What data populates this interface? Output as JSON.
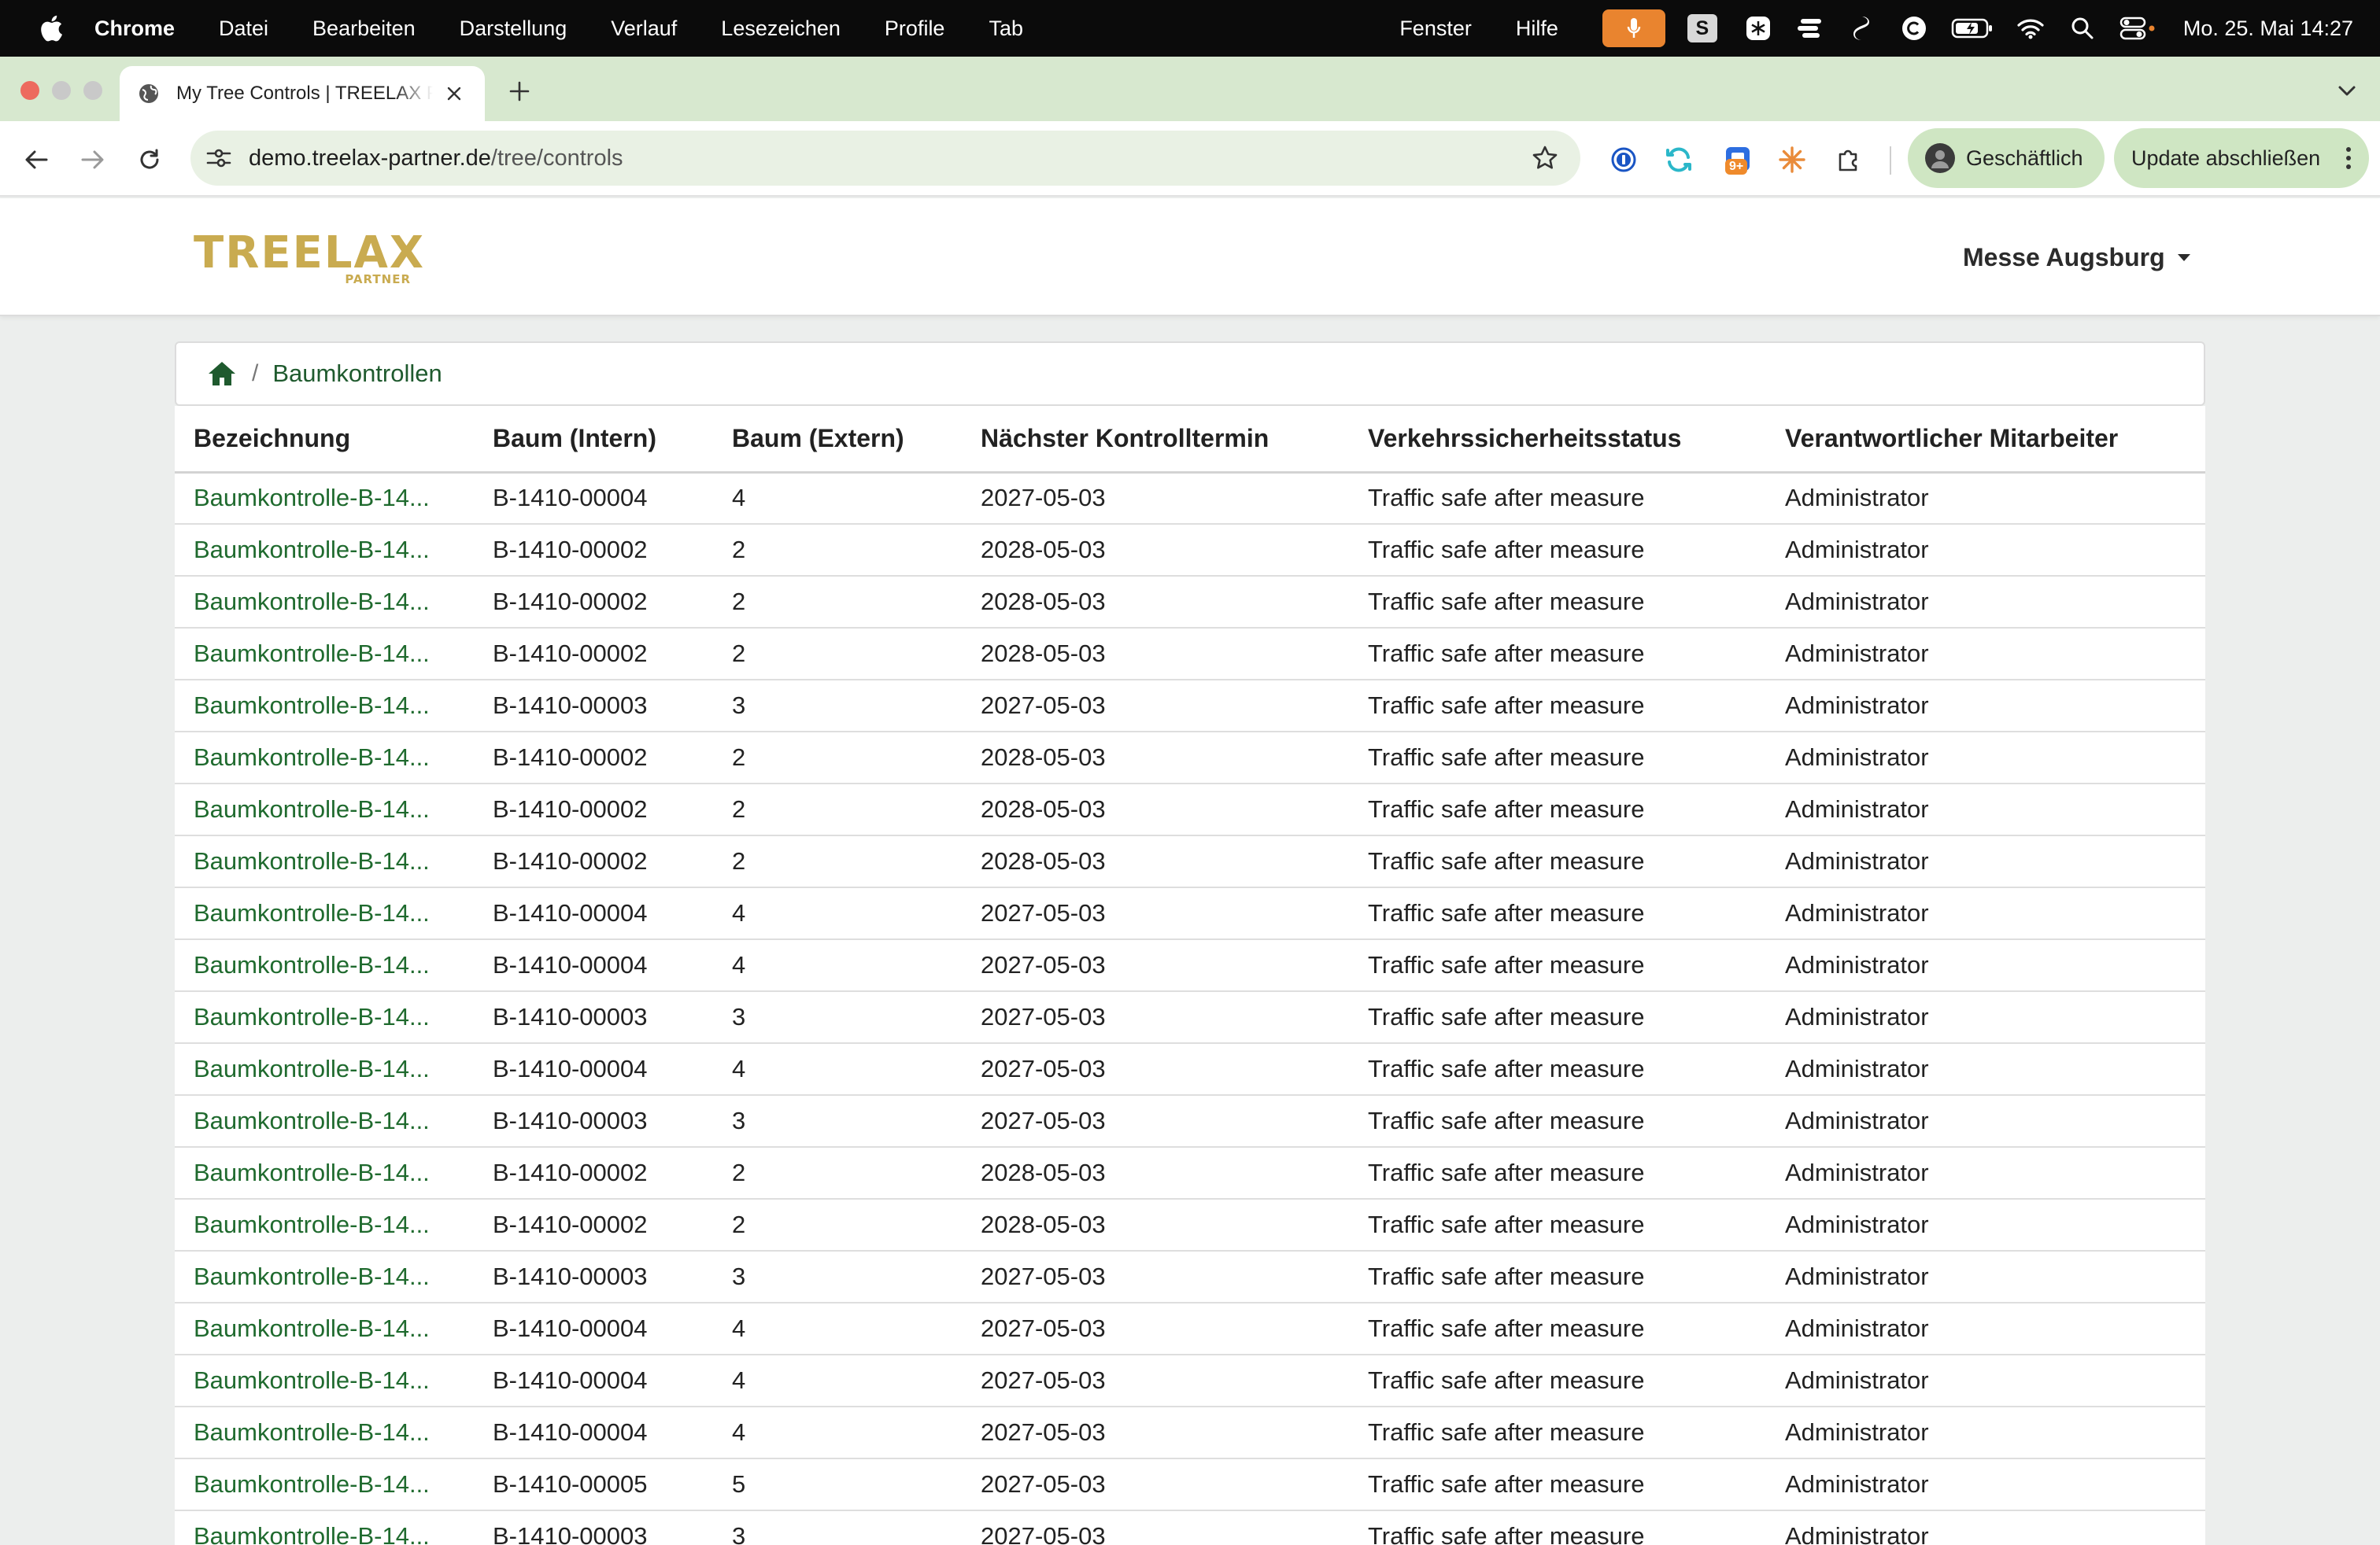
{
  "menubar": {
    "app_name": "Chrome",
    "menus": [
      "Datei",
      "Bearbeiten",
      "Darstellung",
      "Verlauf",
      "Lesezeichen",
      "Profile",
      "Tab"
    ],
    "right_menus": [
      "Fenster",
      "Hilfe"
    ],
    "s_icon_label": "S",
    "clock": "Mo. 25. Mai  14:27",
    "accent_color": "#e9842f"
  },
  "browser": {
    "tab_title": "My Tree Controls | TREELAX Partner",
    "url_host": "demo.treelax-partner.de",
    "url_path": "/tree/controls",
    "extension_badge": "9+",
    "profile_label": "Geschäftlich",
    "update_label": "Update abschließen",
    "chrome_color": "#d7e8cf"
  },
  "header": {
    "logo_text": "TREELAX",
    "logo_subtext": "PARTNER",
    "org_selector": "Messe Augsburg",
    "brand_color": "#c9ab50"
  },
  "breadcrumb": {
    "current": "Baumkontrollen"
  },
  "table": {
    "columns": [
      "Bezeichnung",
      "Baum (Intern)",
      "Baum (Extern)",
      "Nächster Kontrolltermin",
      "Verkehrssicherheitsstatus",
      "Verantwortlicher Mitarbeiter"
    ],
    "rows": [
      {
        "name": "Baumkontrolle-B-14...",
        "intern": "B-1410-00004",
        "extern": "4",
        "next": "2027-05-03",
        "status": "Traffic safe after measure",
        "employee": "Administrator"
      },
      {
        "name": "Baumkontrolle-B-14...",
        "intern": "B-1410-00002",
        "extern": "2",
        "next": "2028-05-03",
        "status": "Traffic safe after measure",
        "employee": "Administrator"
      },
      {
        "name": "Baumkontrolle-B-14...",
        "intern": "B-1410-00002",
        "extern": "2",
        "next": "2028-05-03",
        "status": "Traffic safe after measure",
        "employee": "Administrator"
      },
      {
        "name": "Baumkontrolle-B-14...",
        "intern": "B-1410-00002",
        "extern": "2",
        "next": "2028-05-03",
        "status": "Traffic safe after measure",
        "employee": "Administrator"
      },
      {
        "name": "Baumkontrolle-B-14...",
        "intern": "B-1410-00003",
        "extern": "3",
        "next": "2027-05-03",
        "status": "Traffic safe after measure",
        "employee": "Administrator"
      },
      {
        "name": "Baumkontrolle-B-14...",
        "intern": "B-1410-00002",
        "extern": "2",
        "next": "2028-05-03",
        "status": "Traffic safe after measure",
        "employee": "Administrator"
      },
      {
        "name": "Baumkontrolle-B-14...",
        "intern": "B-1410-00002",
        "extern": "2",
        "next": "2028-05-03",
        "status": "Traffic safe after measure",
        "employee": "Administrator"
      },
      {
        "name": "Baumkontrolle-B-14...",
        "intern": "B-1410-00002",
        "extern": "2",
        "next": "2028-05-03",
        "status": "Traffic safe after measure",
        "employee": "Administrator"
      },
      {
        "name": "Baumkontrolle-B-14...",
        "intern": "B-1410-00004",
        "extern": "4",
        "next": "2027-05-03",
        "status": "Traffic safe after measure",
        "employee": "Administrator"
      },
      {
        "name": "Baumkontrolle-B-14...",
        "intern": "B-1410-00004",
        "extern": "4",
        "next": "2027-05-03",
        "status": "Traffic safe after measure",
        "employee": "Administrator"
      },
      {
        "name": "Baumkontrolle-B-14...",
        "intern": "B-1410-00003",
        "extern": "3",
        "next": "2027-05-03",
        "status": "Traffic safe after measure",
        "employee": "Administrator"
      },
      {
        "name": "Baumkontrolle-B-14...",
        "intern": "B-1410-00004",
        "extern": "4",
        "next": "2027-05-03",
        "status": "Traffic safe after measure",
        "employee": "Administrator"
      },
      {
        "name": "Baumkontrolle-B-14...",
        "intern": "B-1410-00003",
        "extern": "3",
        "next": "2027-05-03",
        "status": "Traffic safe after measure",
        "employee": "Administrator"
      },
      {
        "name": "Baumkontrolle-B-14...",
        "intern": "B-1410-00002",
        "extern": "2",
        "next": "2028-05-03",
        "status": "Traffic safe after measure",
        "employee": "Administrator"
      },
      {
        "name": "Baumkontrolle-B-14...",
        "intern": "B-1410-00002",
        "extern": "2",
        "next": "2028-05-03",
        "status": "Traffic safe after measure",
        "employee": "Administrator"
      },
      {
        "name": "Baumkontrolle-B-14...",
        "intern": "B-1410-00003",
        "extern": "3",
        "next": "2027-05-03",
        "status": "Traffic safe after measure",
        "employee": "Administrator"
      },
      {
        "name": "Baumkontrolle-B-14...",
        "intern": "B-1410-00004",
        "extern": "4",
        "next": "2027-05-03",
        "status": "Traffic safe after measure",
        "employee": "Administrator"
      },
      {
        "name": "Baumkontrolle-B-14...",
        "intern": "B-1410-00004",
        "extern": "4",
        "next": "2027-05-03",
        "status": "Traffic safe after measure",
        "employee": "Administrator"
      },
      {
        "name": "Baumkontrolle-B-14...",
        "intern": "B-1410-00004",
        "extern": "4",
        "next": "2027-05-03",
        "status": "Traffic safe after measure",
        "employee": "Administrator"
      },
      {
        "name": "Baumkontrolle-B-14...",
        "intern": "B-1410-00005",
        "extern": "5",
        "next": "2027-05-03",
        "status": "Traffic safe after measure",
        "employee": "Administrator"
      },
      {
        "name": "Baumkontrolle-B-14...",
        "intern": "B-1410-00003",
        "extern": "3",
        "next": "2027-05-03",
        "status": "Traffic safe after measure",
        "employee": "Administrator"
      }
    ]
  },
  "icons": {
    "apple": "apple-icon",
    "mic": "microphone-icon",
    "wifi": "wifi-icon",
    "search": "search-icon",
    "battery": "battery-icon",
    "control_center": "control-center-icon",
    "back": "back-arrow-icon",
    "forward": "forward-arrow-icon",
    "reload": "reload-icon",
    "site_settings": "site-settings-icon",
    "bookmark": "star-icon",
    "home": "home-icon"
  }
}
